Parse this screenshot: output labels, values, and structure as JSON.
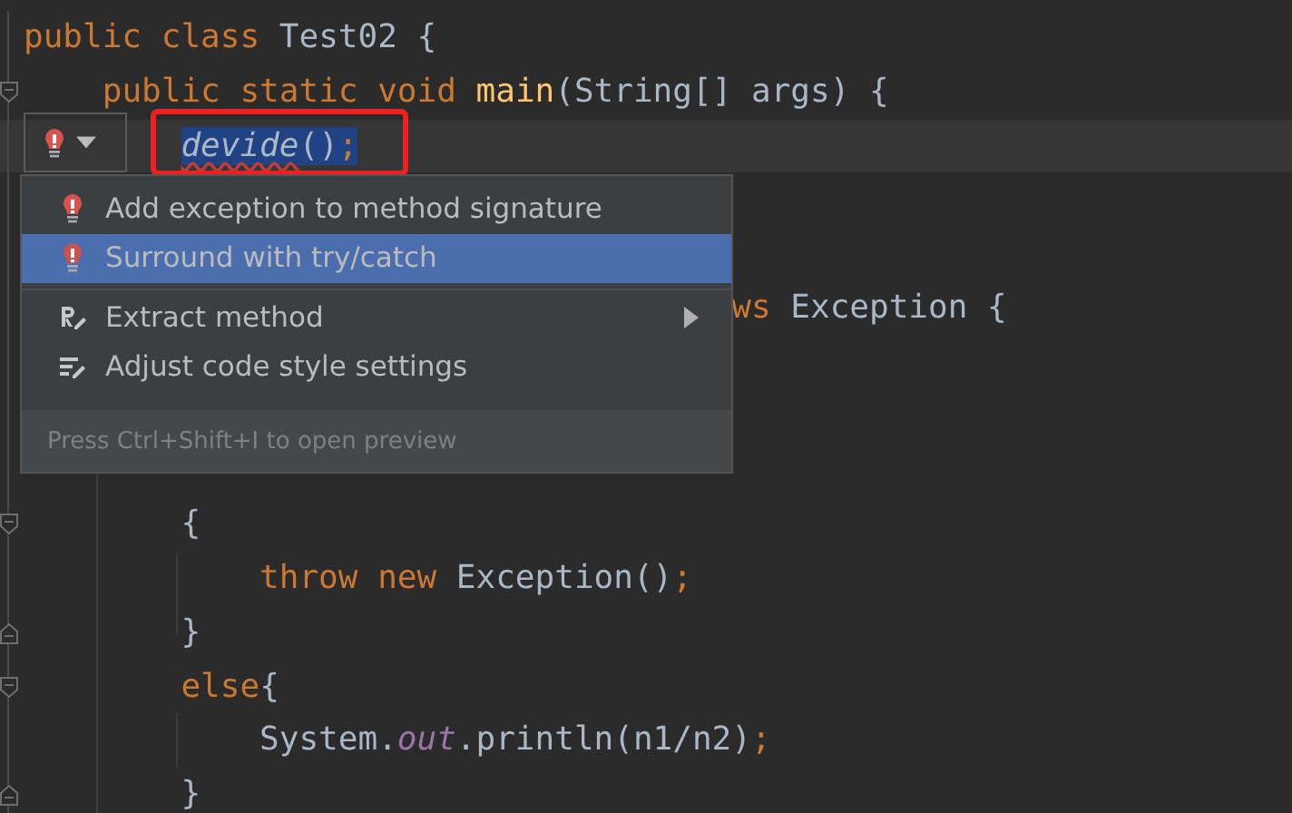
{
  "editor": {
    "lines": [
      {
        "kind": "code",
        "tokens": [
          {
            "text": "public class ",
            "kind": "keyword"
          },
          {
            "text": "Test02 {",
            "kind": "plain"
          }
        ]
      },
      {
        "kind": "code",
        "tokens": [
          {
            "text": "    public static void ",
            "kind": "keyword"
          },
          {
            "text": "main",
            "kind": "method"
          },
          {
            "text": "(String[] args) {",
            "kind": "plain"
          }
        ]
      },
      {
        "kind": "code",
        "boxed": true,
        "tokens": [
          {
            "text": "        devide",
            "kind": "static-call",
            "selected": true,
            "error": true
          },
          {
            "text": "()",
            "kind": "plain",
            "selected": true
          },
          {
            "text": ";",
            "kind": "keyword",
            "selected": true
          }
        ]
      },
      {
        "kind": "covered"
      },
      {
        "kind": "covered"
      },
      {
        "kind": "code",
        "tokens": [
          {
            "text": "                                    ws ",
            "kind": "keyword"
          },
          {
            "text": "Exception {",
            "kind": "plain"
          }
        ]
      },
      {
        "kind": "covered"
      },
      {
        "kind": "covered"
      },
      {
        "kind": "covered"
      },
      {
        "kind": "code",
        "tokens": [
          {
            "text": "        {",
            "kind": "plain"
          }
        ]
      },
      {
        "kind": "code",
        "tokens": [
          {
            "text": "            throw new ",
            "kind": "keyword"
          },
          {
            "text": "Exception()",
            "kind": "plain"
          },
          {
            "text": ";",
            "kind": "keyword"
          }
        ]
      },
      {
        "kind": "code",
        "tokens": [
          {
            "text": "        }",
            "kind": "plain"
          }
        ]
      },
      {
        "kind": "code",
        "tokens": [
          {
            "text": "        else",
            "kind": "keyword"
          },
          {
            "text": "{",
            "kind": "plain"
          }
        ]
      },
      {
        "kind": "code",
        "tokens": [
          {
            "text": "            System.",
            "kind": "plain"
          },
          {
            "text": "out",
            "kind": "static-field"
          },
          {
            "text": ".println(n1/n2)",
            "kind": "plain"
          },
          {
            "text": ";",
            "kind": "keyword"
          }
        ]
      },
      {
        "kind": "code",
        "tokens": [
          {
            "text": "        }",
            "kind": "plain"
          }
        ]
      }
    ]
  },
  "popup": {
    "groups": [
      [
        {
          "label": "Add exception to method signature",
          "kind": "quickfix",
          "selected": false,
          "submenu": false
        },
        {
          "label": "Surround with try/catch",
          "kind": "quickfix",
          "selected": true,
          "submenu": false
        }
      ],
      [
        {
          "label": "Extract method",
          "kind": "refactor",
          "selected": false,
          "submenu": true
        },
        {
          "label": "Adjust code style settings",
          "kind": "style",
          "selected": false,
          "submenu": false
        }
      ]
    ],
    "footer": "Press Ctrl+Shift+I to open preview"
  }
}
